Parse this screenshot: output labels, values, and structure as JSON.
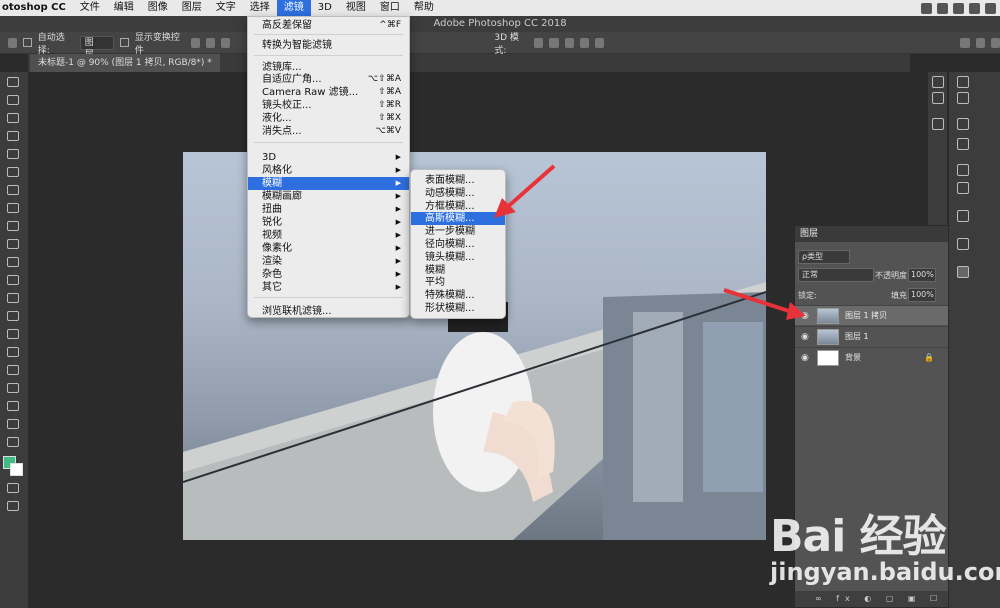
{
  "menubar": {
    "app": "otoshop CC",
    "items": [
      "文件",
      "编辑",
      "图像",
      "图层",
      "文字",
      "选择",
      "滤镜",
      "3D",
      "视图",
      "窗口",
      "帮助"
    ],
    "active_index": 6
  },
  "titlebar": {
    "title": "Adobe Photoshop CC 2018"
  },
  "optbar": {
    "auto_select_label": "自动选择:",
    "auto_select_value": "图层",
    "show_transform_label": "显示变换控件",
    "mode_3d_label": "3D 模式:"
  },
  "tab": {
    "label": "未标题-1 @ 90% (图层 1 拷贝, RGB/8*) *"
  },
  "filter_menu": {
    "items": [
      {
        "label": "高反差保留",
        "shortcut": "^⌘F"
      },
      {
        "label": "转换为智能滤镜",
        "shortcut": ""
      },
      {
        "label": "滤镜库...",
        "shortcut": ""
      },
      {
        "label": "自适应广角...",
        "shortcut": "⌥⇧⌘A"
      },
      {
        "label": "Camera Raw 滤镜...",
        "shortcut": "⇧⌘A"
      },
      {
        "label": "镜头校正...",
        "shortcut": "⇧⌘R"
      },
      {
        "label": "液化...",
        "shortcut": "⇧⌘X"
      },
      {
        "label": "消失点...",
        "shortcut": "⌥⌘V"
      },
      {
        "label": "3D",
        "shortcut": ""
      },
      {
        "label": "风格化",
        "shortcut": ""
      },
      {
        "label": "模糊",
        "shortcut": ""
      },
      {
        "label": "模糊画廊",
        "shortcut": ""
      },
      {
        "label": "扭曲",
        "shortcut": ""
      },
      {
        "label": "锐化",
        "shortcut": ""
      },
      {
        "label": "视频",
        "shortcut": ""
      },
      {
        "label": "像素化",
        "shortcut": ""
      },
      {
        "label": "渲染",
        "shortcut": ""
      },
      {
        "label": "杂色",
        "shortcut": ""
      },
      {
        "label": "其它",
        "shortcut": ""
      },
      {
        "label": "浏览联机滤镜...",
        "shortcut": ""
      }
    ]
  },
  "blur_menu": {
    "items": [
      "表面模糊...",
      "动感模糊...",
      "方框模糊...",
      "高斯模糊...",
      "进一步模糊",
      "径向模糊...",
      "镜头模糊...",
      "模糊",
      "平均",
      "特殊模糊...",
      "形状模糊..."
    ],
    "highlighted_index": 3
  },
  "layers_panel": {
    "title": "图层",
    "kind_label": "ρ类型",
    "blend_mode": "正常",
    "opacity_label": "不透明度:",
    "opacity_value": "100%",
    "lock_label": "锁定:",
    "fill_label": "填充:",
    "fill_value": "100%",
    "layers": [
      {
        "name": "图层 1 拷贝",
        "selected": true
      },
      {
        "name": "图层 1",
        "selected": false
      },
      {
        "name": "背景",
        "selected": false
      }
    ],
    "footer": "∞ fx ◐ ▢ ▣ ☐ 🗑"
  },
  "watermark": {
    "logo": "Bai 经验",
    "url": "jingyan.baidu.com"
  },
  "colors": {
    "accent": "#2e6fe0",
    "arrow": "#e8323a"
  }
}
